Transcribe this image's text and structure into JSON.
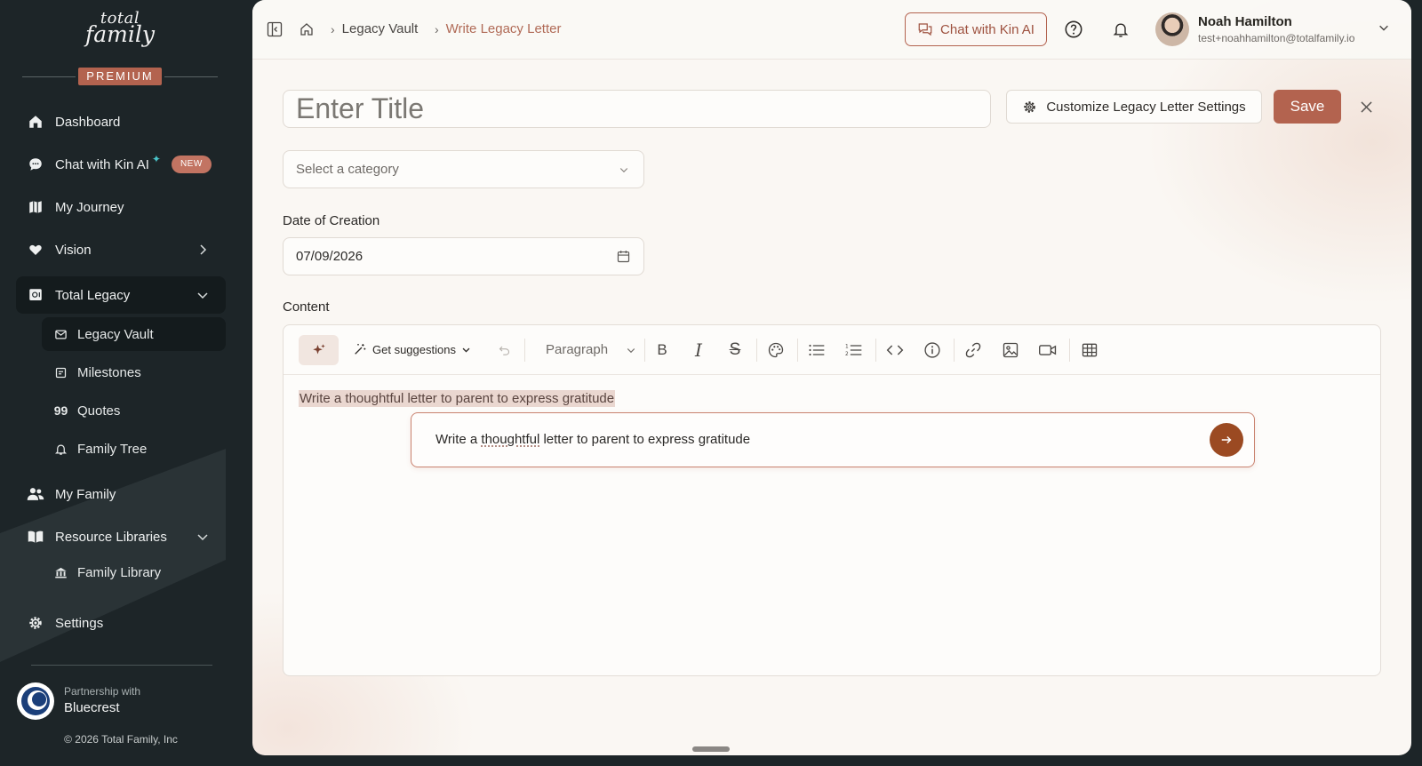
{
  "brand": {
    "logo_line1": "total",
    "logo_line2": "family",
    "tier": "PREMIUM"
  },
  "sidebar": {
    "items": [
      {
        "label": "Dashboard",
        "icon": "home-icon"
      },
      {
        "label": "Chat with Kin AI",
        "icon": "chat-bubble-icon",
        "badge": "NEW"
      },
      {
        "label": "My Journey",
        "icon": "map-icon"
      },
      {
        "label": "Vision",
        "icon": "heart-icon"
      },
      {
        "label": "Total Legacy",
        "icon": "safe-icon",
        "expanded": true
      },
      {
        "label": "My Family",
        "icon": "users-icon"
      },
      {
        "label": "Resource Libraries",
        "icon": "book-icon",
        "expanded": true
      },
      {
        "label": "Settings",
        "icon": "gear-icon"
      }
    ],
    "legacy_subitems": [
      {
        "label": "Legacy Vault",
        "icon": "envelope-icon",
        "active": true
      },
      {
        "label": "Milestones",
        "icon": "calendar-note-icon"
      },
      {
        "label": "Quotes",
        "icon": "quote-icon"
      },
      {
        "label": "Family Tree",
        "icon": "bell-icon"
      }
    ],
    "library_subitems": [
      {
        "label": "Family Library",
        "icon": "building-icon"
      }
    ],
    "partner": {
      "caption": "Partnership with",
      "name": "Bluecrest"
    },
    "copyright": "© 2026 Total Family, Inc"
  },
  "header": {
    "breadcrumbs": [
      "Legacy Vault",
      "Write Legacy Letter"
    ],
    "chat_button": "Chat with Kin AI",
    "user": {
      "name": "Noah Hamilton",
      "email": "test+noahhamilton@totalfamily.io"
    }
  },
  "form": {
    "title_placeholder": "Enter Title",
    "customize_button": "Customize Legacy Letter Settings",
    "save_button": "Save",
    "category_placeholder": "Select a category",
    "date_label": "Date of Creation",
    "date_value": "07/09/2026",
    "content_label": "Content"
  },
  "editor": {
    "suggestions_label": "Get suggestions",
    "paragraph_label": "Paragraph",
    "highlighted_text": "Write a thoughtful letter to parent to express gratitude",
    "prompt": {
      "before": "Write a ",
      "underlined": "thoughtful",
      "after": " letter to parent to express gratitude"
    }
  },
  "colors": {
    "accent": "#b3634f",
    "sidebar_bg": "#1d2528",
    "send_button": "#9b4a22",
    "sparkle": "#49c3c8"
  }
}
